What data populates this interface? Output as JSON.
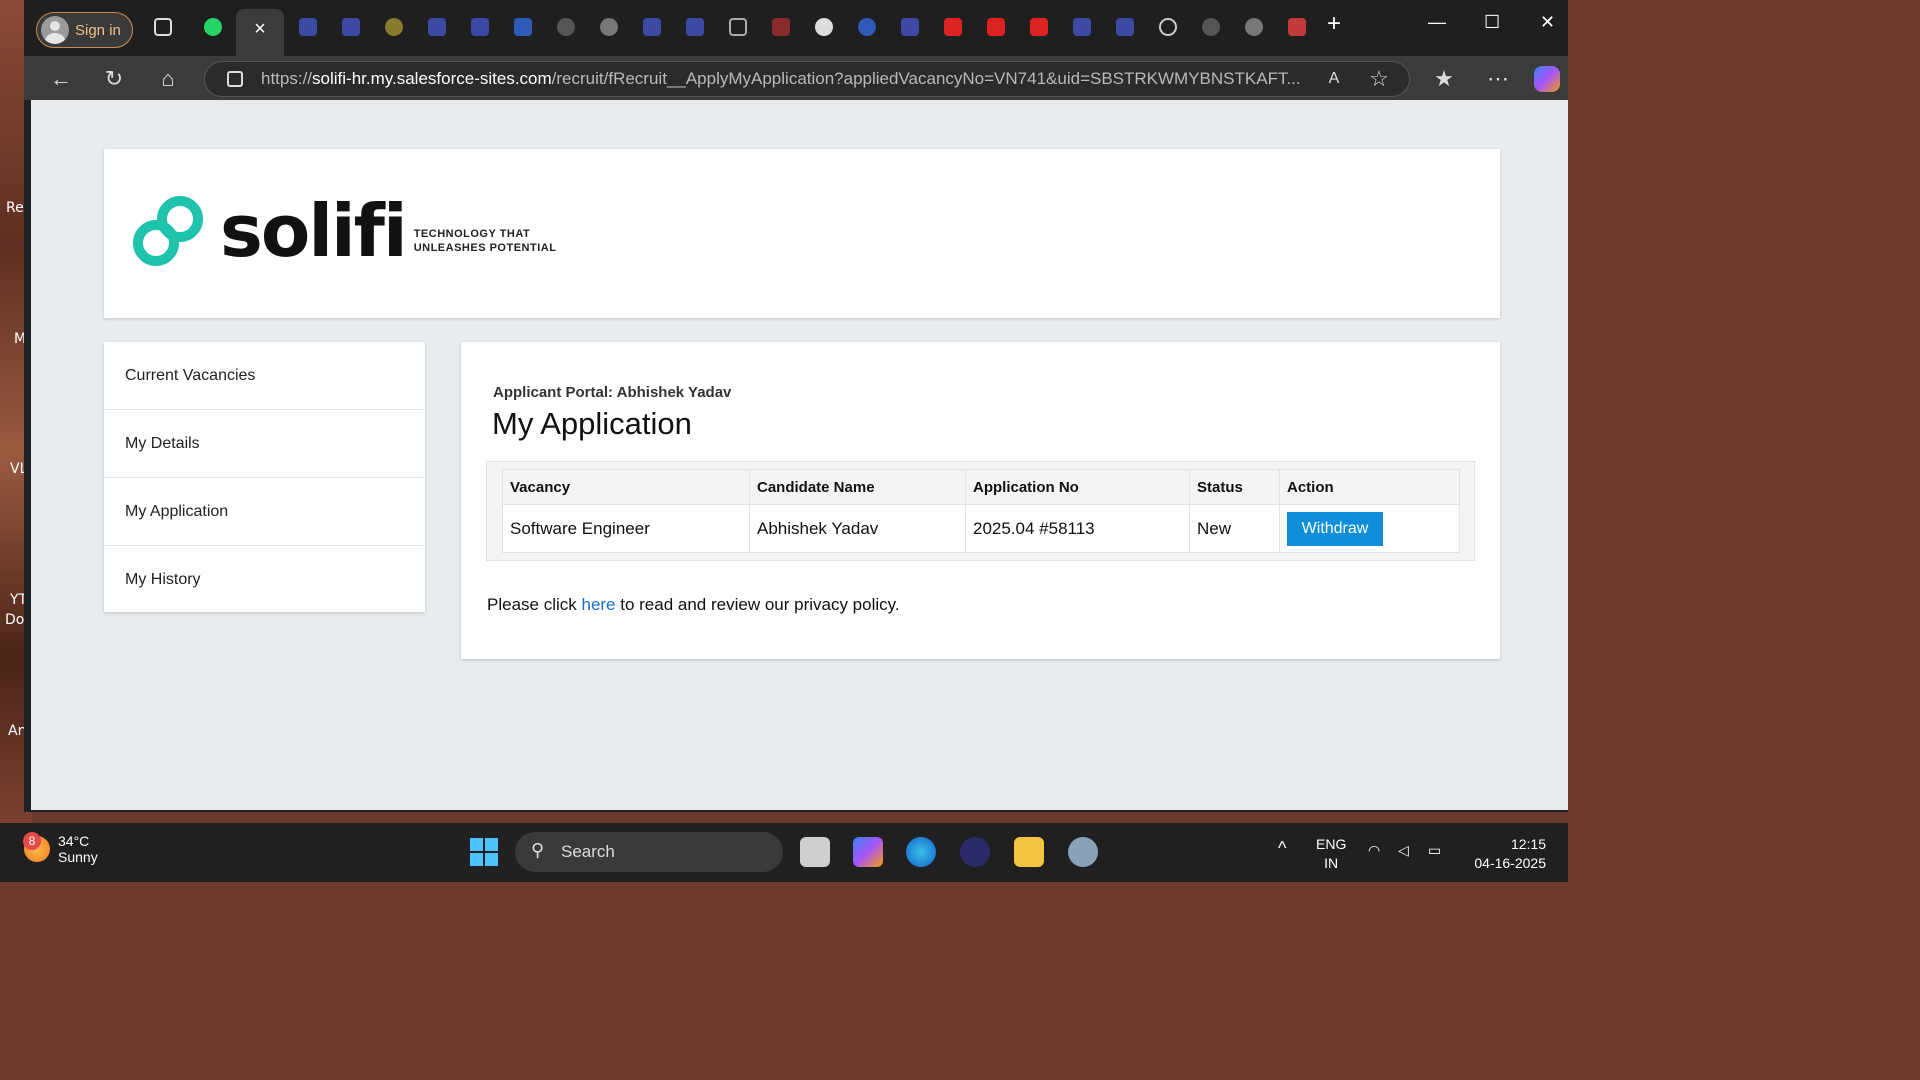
{
  "desktop": {
    "labels": [
      "Re",
      "M",
      "VL",
      "YT",
      "Do",
      "An"
    ]
  },
  "browser": {
    "signin_label": "Sign in",
    "url_host": "solifi-hr.my.salesforce-sites.com",
    "url_path": "/recruit/fRecruit__ApplyMyApplication?appliedVacancyNo=VN741&uid=SBSTRKWMYBNSTKAFT...",
    "url_scheme": "https://"
  },
  "header": {
    "logo_word": "solifi",
    "tagline_1": "TECHNOLOGY THAT",
    "tagline_2": "UNLEASHES POTENTIAL",
    "brand_color": "#1fc3ab"
  },
  "sidebar": {
    "items": [
      {
        "label": "Current Vacancies"
      },
      {
        "label": "My Details"
      },
      {
        "label": "My Application"
      },
      {
        "label": "My History"
      }
    ]
  },
  "main": {
    "portal_label": "Applicant Portal: Abhishek Yadav",
    "title": "My Application",
    "table": {
      "headers": [
        "Vacancy",
        "Candidate Name",
        "Application No",
        "Status",
        "Action"
      ],
      "rows": [
        {
          "vacancy": "Software Engineer",
          "candidate": "Abhishek Yadav",
          "application_no": "2025.04 #58113",
          "status": "New",
          "action_label": "Withdraw"
        }
      ]
    },
    "privacy_prefix": "Please click ",
    "privacy_link": "here",
    "privacy_suffix": " to read and review our privacy policy."
  },
  "taskbar": {
    "temperature": "34°C",
    "condition": "Sunny",
    "weather_badge": "8",
    "search_placeholder": "Search",
    "language_1": "ENG",
    "language_2": "IN",
    "time": "12:15",
    "date": "04-16-2025"
  }
}
